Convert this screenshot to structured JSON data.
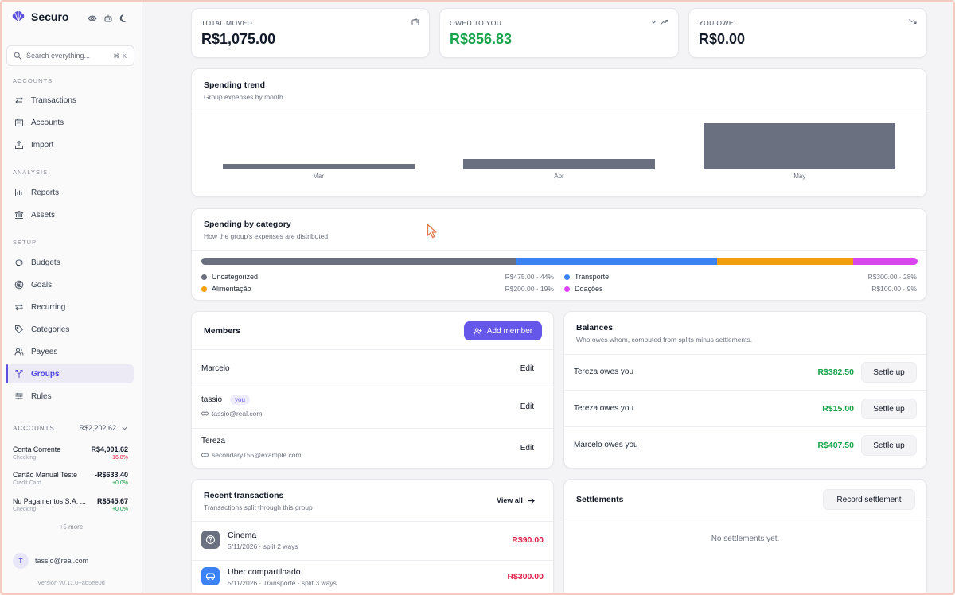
{
  "app": {
    "name": "Securo"
  },
  "search": {
    "placeholder": "Search everything...",
    "shortcut": "⌘ K"
  },
  "sidebar": {
    "sections": [
      {
        "title": "ACCOUNTS",
        "items": [
          {
            "label": "Transactions",
            "icon": "arrows-swap-icon"
          },
          {
            "label": "Accounts",
            "icon": "building-icon"
          },
          {
            "label": "Import",
            "icon": "upload-icon"
          }
        ]
      },
      {
        "title": "ANALYSIS",
        "items": [
          {
            "label": "Reports",
            "icon": "bar-chart-icon"
          },
          {
            "label": "Assets",
            "icon": "bank-icon"
          }
        ]
      },
      {
        "title": "SETUP",
        "items": [
          {
            "label": "Budgets",
            "icon": "piggy-bank-icon"
          },
          {
            "label": "Goals",
            "icon": "target-icon"
          },
          {
            "label": "Recurring",
            "icon": "repeat-icon"
          },
          {
            "label": "Categories",
            "icon": "tag-icon"
          },
          {
            "label": "Payees",
            "icon": "users-icon"
          },
          {
            "label": "Groups",
            "icon": "split-icon",
            "active": true
          },
          {
            "label": "Rules",
            "icon": "sliders-icon"
          }
        ]
      }
    ],
    "accounts_header": {
      "title": "ACCOUNTS",
      "total": "R$2,202.62"
    },
    "accounts": [
      {
        "name": "Conta Corrente",
        "type": "Checking",
        "balance": "R$4,001.62",
        "change": "-16.8%",
        "trend": "neg"
      },
      {
        "name": "Cartão Manual Teste",
        "type": "Credit Card",
        "balance": "-R$633.40",
        "change": "+0.0%",
        "trend": "pos"
      },
      {
        "name": "Nu Pagamentos S.A. ...",
        "type": "Checking",
        "balance": "R$545.67",
        "change": "+0.0%",
        "trend": "pos"
      }
    ],
    "more": "+5 more",
    "user": {
      "initial": "T",
      "email": "tassio@real.com"
    },
    "version": "Version v0.11.0+ab5ee0d"
  },
  "stats": [
    {
      "label": "TOTAL MOVED",
      "value": "R$1,075.00",
      "color": "#111827"
    },
    {
      "label": "OWED TO YOU",
      "value": "R$856.83",
      "color": "#16a34a"
    },
    {
      "label": "YOU OWE",
      "value": "R$0.00",
      "color": "#111827"
    }
  ],
  "trend": {
    "title": "Spending trend",
    "subtitle": "Group expenses by month",
    "chart_data": {
      "type": "bar",
      "categories": [
        "Mar",
        "Apr",
        "May"
      ],
      "values": [
        55,
        108,
        475
      ],
      "ylim": [
        0,
        475
      ],
      "color": "#6b7080",
      "grid": false
    }
  },
  "category": {
    "title": "Spending by category",
    "subtitle": "How the group's expenses are distributed",
    "items": [
      {
        "name": "Uncategorized",
        "value": "R$475.00 · 44%",
        "pct": 44,
        "color": "#6b7080"
      },
      {
        "name": "Transporte",
        "value": "R$300.00 · 28%",
        "pct": 28,
        "color": "#3b82f6"
      },
      {
        "name": "Alimentação",
        "value": "R$200.00 · 19%",
        "pct": 19,
        "color": "#f59e0b"
      },
      {
        "name": "Doações",
        "value": "R$100.00 · 9%",
        "pct": 9,
        "color": "#d946ef"
      }
    ]
  },
  "members": {
    "title": "Members",
    "add_label": "Add member",
    "edit_label": "Edit",
    "you_label": "you",
    "list": [
      {
        "name": "Marcelo"
      },
      {
        "name": "tassio",
        "email": "tassio@real.com",
        "you": true
      },
      {
        "name": "Tereza",
        "email": "secondary155@example.com"
      }
    ]
  },
  "balances": {
    "title": "Balances",
    "subtitle": "Who owes whom, computed from splits minus settlements.",
    "settle_label": "Settle up",
    "list": [
      {
        "text": "Tereza owes you",
        "amount": "R$382.50"
      },
      {
        "text": "Tereza owes you",
        "amount": "R$15.00"
      },
      {
        "text": "Marcelo owes you",
        "amount": "R$407.50"
      }
    ]
  },
  "transactions": {
    "title": "Recent transactions",
    "subtitle": "Transactions split through this group",
    "view_all": "View all",
    "list": [
      {
        "name": "Cinema",
        "meta": "5/11/2026 · split 2 ways",
        "amount": "R$90.00",
        "icon": "question-circle-icon",
        "color": "#6b7080"
      },
      {
        "name": "Uber compartilhado",
        "meta": "5/11/2026 · Transporte · split 3 ways",
        "amount": "R$300.00",
        "icon": "car-icon",
        "color": "#3b82f6"
      }
    ]
  },
  "settlements": {
    "title": "Settlements",
    "record_label": "Record settlement",
    "empty": "No settlements yet."
  }
}
